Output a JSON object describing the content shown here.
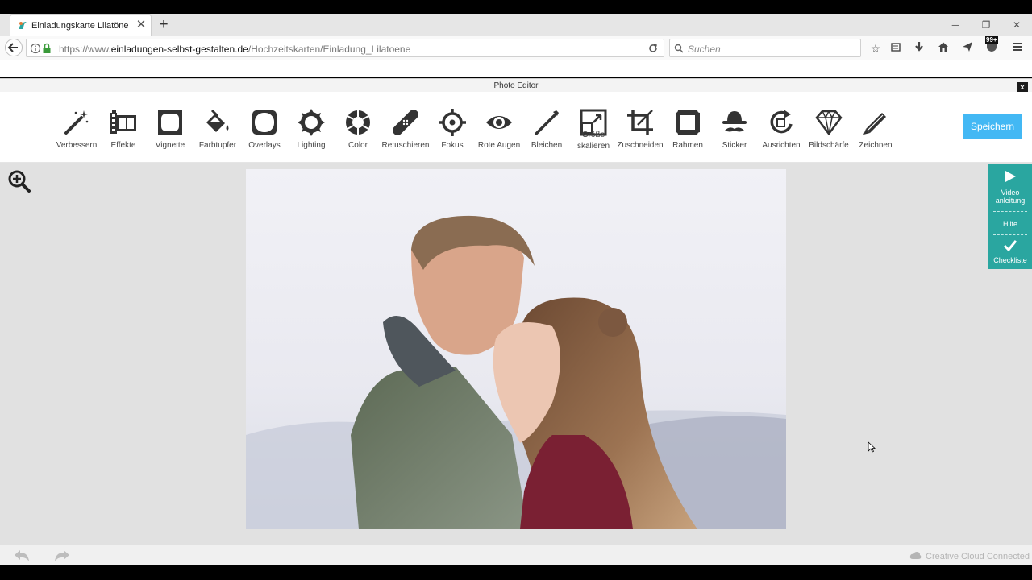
{
  "browser": {
    "tab_title": "Einladungskarte Lilatöne",
    "url_prefix": "https://www.",
    "url_domain": "einladungen-selbst-gestalten.de",
    "url_path": "/Hochzeitskarten/Einladung_Lilatoene",
    "search_placeholder": "Suchen",
    "notification_badge": "99+"
  },
  "editor": {
    "title": "Photo Editor",
    "close_label": "x",
    "save_label": "Speichern",
    "tools": [
      {
        "label": "Verbessern",
        "icon": "magic-wand-icon"
      },
      {
        "label": "Effekte",
        "icon": "film-icon"
      },
      {
        "label": "Vignette",
        "icon": "vignette-icon"
      },
      {
        "label": "Farbtupfer",
        "icon": "paint-bucket-icon"
      },
      {
        "label": "Overlays",
        "icon": "overlay-icon"
      },
      {
        "label": "Lighting",
        "icon": "sun-icon"
      },
      {
        "label": "Color",
        "icon": "aperture-icon"
      },
      {
        "label": "Retuschieren",
        "icon": "bandage-icon"
      },
      {
        "label": "Fokus",
        "icon": "focus-icon"
      },
      {
        "label": "Rote Augen",
        "icon": "eye-icon"
      },
      {
        "label": "Bleichen",
        "icon": "wand-icon"
      },
      {
        "label": "Größe\nskalieren",
        "icon": "resize-icon"
      },
      {
        "label": "Zuschneiden",
        "icon": "crop-icon"
      },
      {
        "label": "Rahmen",
        "icon": "frame-icon"
      },
      {
        "label": "Sticker",
        "icon": "hat-mustache-icon"
      },
      {
        "label": "Ausrichten",
        "icon": "rotate-icon"
      },
      {
        "label": "Bildschärfe",
        "icon": "diamond-icon"
      },
      {
        "label": "Zeichnen",
        "icon": "pencil-icon"
      }
    ],
    "help": {
      "video_label": "Video anleitung",
      "help_label": "Hilfe",
      "checklist_label": "Checkliste"
    },
    "footer": {
      "cc_label": "Creative Cloud Connected"
    }
  },
  "colors": {
    "accent": "#43b8f4",
    "help_panel": "#2aa6a0"
  }
}
